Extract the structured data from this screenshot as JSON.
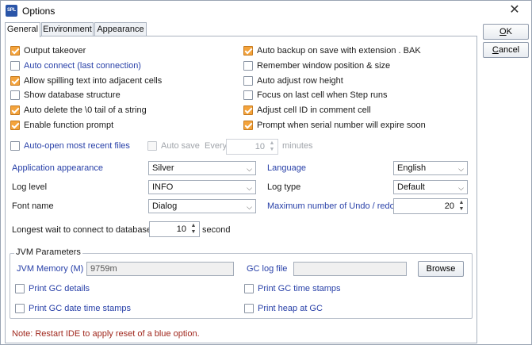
{
  "window": {
    "title": "Options",
    "logo_text": "SPL",
    "close_glyph": "✕"
  },
  "tabs": [
    {
      "label": "General",
      "active": true
    },
    {
      "label": "Environment",
      "active": false
    },
    {
      "label": "Appearance",
      "active": false
    }
  ],
  "buttons": {
    "ok_label": "OK",
    "ok_underline": "O",
    "ok_rest": "K",
    "cancel_label": "Cancel",
    "cancel_underline": "C",
    "cancel_rest": "ancel",
    "browse_label": "Browse"
  },
  "left_checks": [
    {
      "label": "Output takeover",
      "checked": true,
      "blue": false
    },
    {
      "label": "Auto connect (last connection)",
      "checked": false,
      "blue": true
    },
    {
      "label": "Allow spilling text into adjacent cells",
      "checked": true,
      "blue": false
    },
    {
      "label": "Show database structure",
      "checked": false,
      "blue": false
    },
    {
      "label": "Auto delete the \\0 tail of a string",
      "checked": true,
      "blue": false
    },
    {
      "label": "Enable function prompt",
      "checked": true,
      "blue": false
    }
  ],
  "right_checks": [
    {
      "label": "Auto backup on save with extension . BAK",
      "checked": true,
      "blue": false
    },
    {
      "label": "Remember window position & size",
      "checked": false,
      "blue": false
    },
    {
      "label": "Auto adjust row height",
      "checked": false,
      "blue": false
    },
    {
      "label": "Focus on last cell when Step runs",
      "checked": false,
      "blue": false
    },
    {
      "label": "Adjust cell ID in comment cell",
      "checked": true,
      "blue": false
    },
    {
      "label": "Prompt when serial number will expire soon",
      "checked": true,
      "blue": false
    }
  ],
  "autoopen": {
    "label": "Auto-open most recent files",
    "checked": false
  },
  "autosave": {
    "label": "Auto save",
    "every_label": "Every",
    "value": "10",
    "unit": "minutes"
  },
  "fields": {
    "appearance": {
      "label": "Application appearance",
      "value": "Silver"
    },
    "language": {
      "label": "Language",
      "value": "English"
    },
    "log_level": {
      "label": "Log level",
      "value": "INFO"
    },
    "log_type": {
      "label": "Log type",
      "value": "Default"
    },
    "font_name": {
      "label": "Font name",
      "value": "Dialog"
    },
    "max_undo": {
      "label": "Maximum number of Undo / redo",
      "value": "20"
    },
    "db_wait": {
      "label": "Longest wait to connect to database",
      "value": "10",
      "unit": "second"
    }
  },
  "jvm": {
    "group_title": "JVM Parameters",
    "memory_label": "JVM  Memory (M)",
    "memory_value": "9759m",
    "gc_log_label": "GC log file",
    "gc_log_value": "",
    "checks": [
      {
        "label": "Print GC details",
        "checked": false
      },
      {
        "label": "Print GC time stamps",
        "checked": false
      },
      {
        "label": "Print GC date time stamps",
        "checked": false
      },
      {
        "label": "Print heap at GC",
        "checked": false
      }
    ]
  },
  "note": "Note: Restart IDE to apply reset of a blue option.",
  "colors": {
    "accent_check": "#f4a33b",
    "blue_label": "#2840a8",
    "note_red": "#a0281e"
  },
  "icons": {
    "dropdown": "chevron-down-icon",
    "spinner": "spinner-arrows-icon",
    "close": "close-icon"
  }
}
